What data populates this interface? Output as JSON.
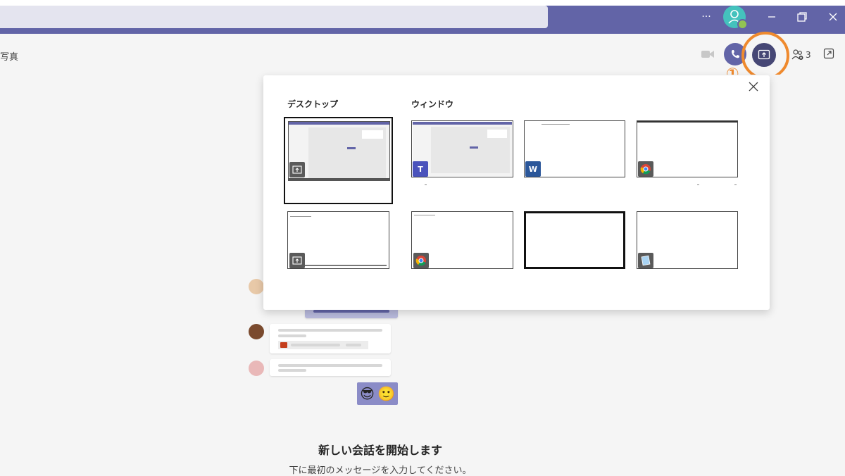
{
  "window": {
    "more_label": "···",
    "minimize_icon": "minimize-icon",
    "restore_icon": "restore-icon",
    "close_icon": "close-icon"
  },
  "search": {
    "placeholder": ""
  },
  "chat_header": {
    "tab_label": "写真",
    "participants_count": "3"
  },
  "annotation": {
    "step_marker": "①",
    "ring_color": "#ef8a2e"
  },
  "share_dialog": {
    "desktop_label": "デスクトップ",
    "window_label": "ウィンドウ",
    "desktop_items": [
      {
        "app": "screen"
      },
      {
        "app": "screen"
      }
    ],
    "window_items": [
      {
        "app": "teams",
        "badge": "T"
      },
      {
        "app": "word",
        "badge": "W"
      },
      {
        "app": "chrome",
        "badge": ""
      },
      {
        "app": "chrome",
        "badge": ""
      },
      {
        "app": "blank",
        "badge": ""
      },
      {
        "app": "notepad",
        "badge": ""
      }
    ]
  },
  "empty_state": {
    "title": "新しい会話を開始します",
    "subtitle": "下に最初のメッセージを入力してください。"
  },
  "colors": {
    "brand": "#6264a7",
    "share_active": "#464775",
    "accent_orange": "#ef8a2e"
  }
}
